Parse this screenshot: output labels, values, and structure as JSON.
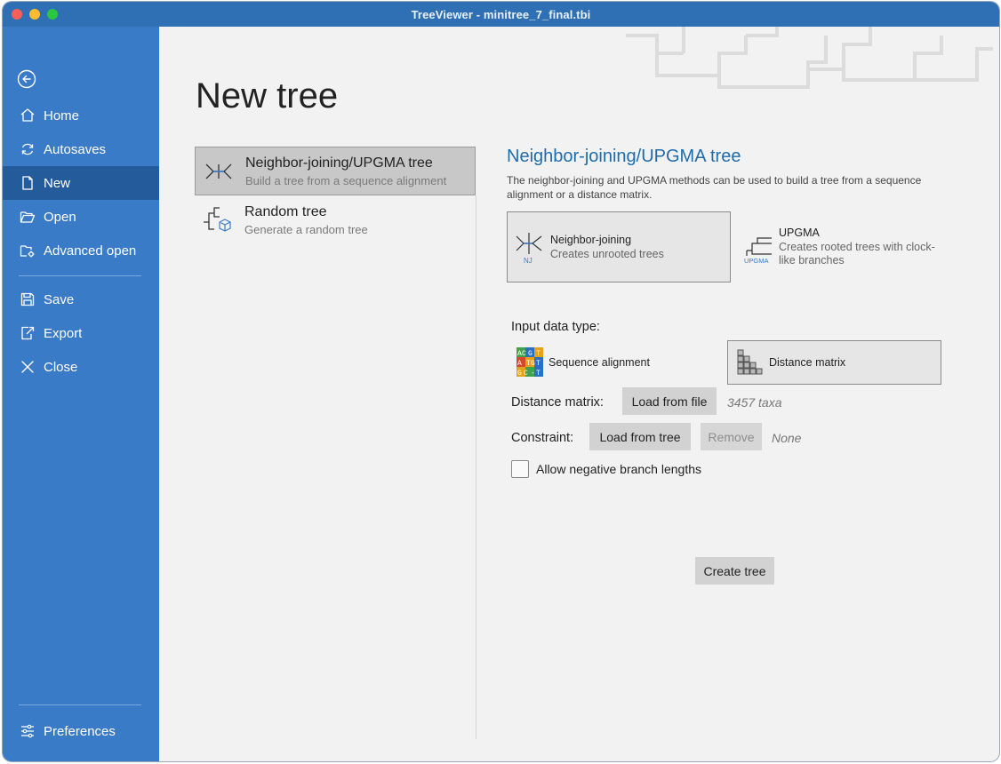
{
  "window": {
    "title": "TreeViewer - minitree_7_final.tbi"
  },
  "sidebar": {
    "items": [
      {
        "label": "Home"
      },
      {
        "label": "Autosaves"
      },
      {
        "label": "New"
      },
      {
        "label": "Open"
      },
      {
        "label": "Advanced open"
      },
      {
        "label": "Save"
      },
      {
        "label": "Export"
      },
      {
        "label": "Close"
      }
    ],
    "preferences": "Preferences"
  },
  "page": {
    "title": "New tree"
  },
  "tree_types": [
    {
      "title": "Neighbor-joining/UPGMA tree",
      "subtitle": "Build a tree from a sequence alignment"
    },
    {
      "title": "Random tree",
      "subtitle": "Generate a random tree"
    }
  ],
  "detail": {
    "title": "Neighbor-joining/UPGMA tree",
    "description": "The neighbor-joining and UPGMA methods can be used to build a tree from a sequence alignment or a distance matrix.",
    "methods": [
      {
        "title": "Neighbor-joining",
        "subtitle": "Creates unrooted trees",
        "icon_text": "NJ"
      },
      {
        "title": "UPGMA",
        "subtitle": "Creates rooted trees with clock-like branches",
        "icon_text": "UPGMA"
      }
    ],
    "input_data_label": "Input data type:",
    "data_types": [
      {
        "label": "Sequence alignment",
        "icon_letters": [
          "A",
          "C",
          "G",
          "T",
          "A",
          "T",
          "G",
          "T",
          "G",
          "C",
          "-",
          "T"
        ]
      },
      {
        "label": "Distance matrix"
      }
    ],
    "distance_matrix": {
      "label": "Distance matrix:",
      "button": "Load from file",
      "value": "3457 taxa"
    },
    "constraint": {
      "label": "Constraint:",
      "button": "Load from tree",
      "remove": "Remove",
      "value": "None"
    },
    "negative_branch": {
      "label": "Allow negative branch lengths"
    },
    "create_button": "Create tree"
  },
  "colors": {
    "sidebar": "#3a7bc8",
    "sidebar_active": "#245b9b",
    "accent": "#1f6cab"
  }
}
